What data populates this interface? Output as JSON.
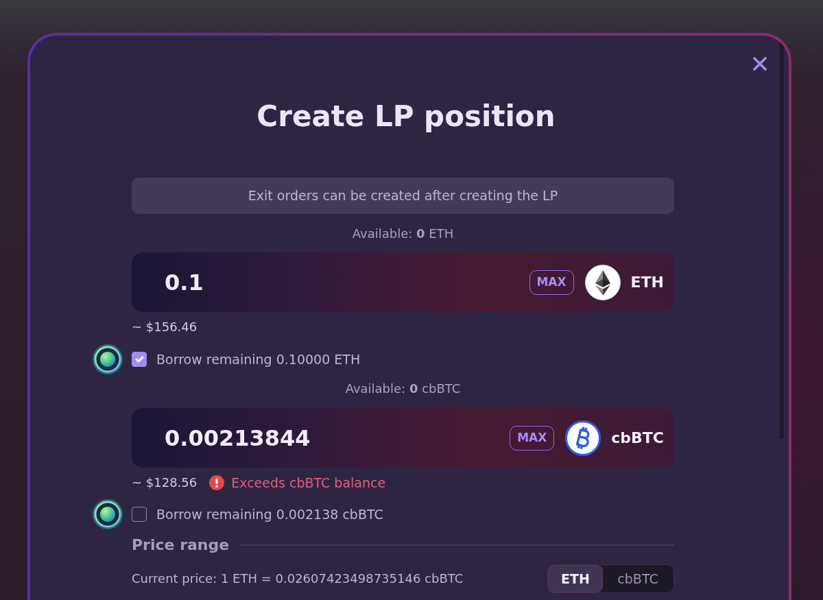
{
  "dialog": {
    "title": "Create LP position"
  },
  "notice": "Exit orders can be created after creating the LP",
  "tokens": [
    {
      "kind": "eth",
      "available": "Available: **0** ETH",
      "amount": "0.1",
      "max_label": "MAX",
      "symbol": "ETH",
      "usd_value": "~ $156.46",
      "borrow": {
        "label": "Borrow remaining 0.10000 ETH",
        "checked": true
      }
    },
    {
      "kind": "btc",
      "available": "Available: **0** cbBTC",
      "amount": "0.00213844",
      "max_label": "MAX",
      "symbol": "cbBTC",
      "usd_value": "~ $128.56",
      "error": "Exceeds cbBTC balance",
      "borrow": {
        "label": "Borrow remaining 0.002138 cbBTC",
        "checked": false
      }
    }
  ],
  "price_range": {
    "heading": "Price range",
    "current_price": "Current price: 1 ETH = 0.02607423498735146 cbBTC",
    "units": [
      {
        "label": "ETH",
        "selected": true
      },
      {
        "label": "cbBTC",
        "selected": false
      }
    ]
  }
}
